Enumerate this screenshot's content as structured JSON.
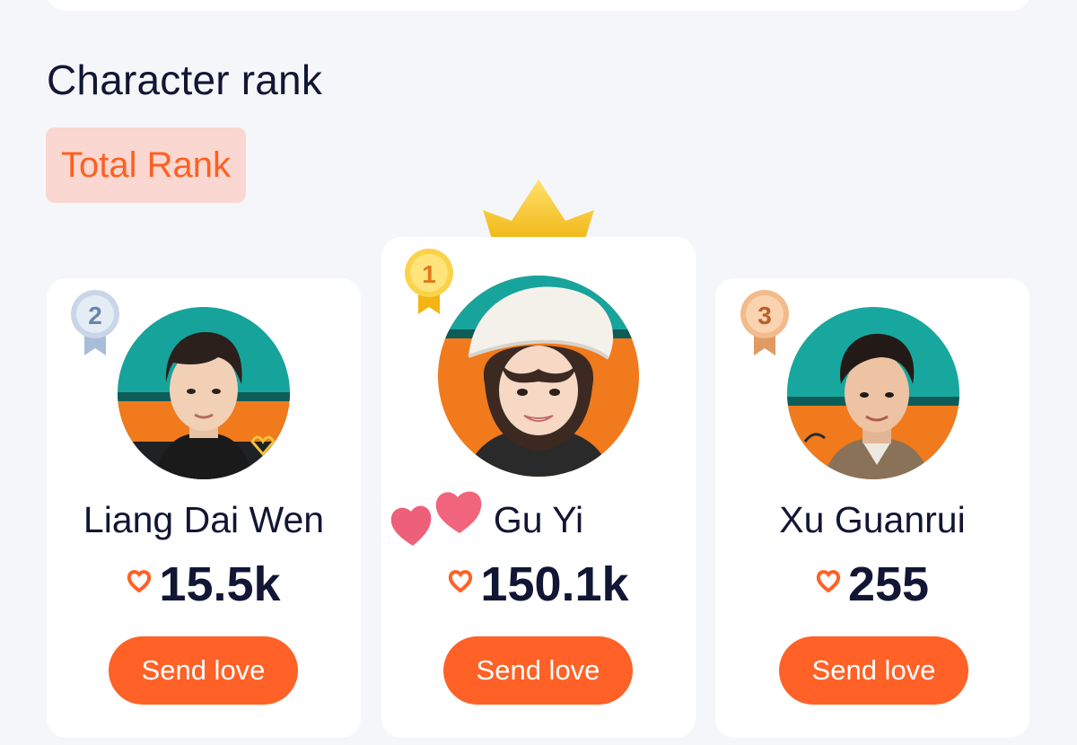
{
  "section": {
    "title": "Character rank",
    "tab_label": "Total Rank"
  },
  "colors": {
    "accent": "#ff6126",
    "tab_bg": "#fad7d0",
    "text_dark": "#121634",
    "page_bg": "#f5f6f9",
    "gold": "#f7c21a",
    "silver": "#aebfd8",
    "bronze": "#e7a673"
  },
  "ranking": [
    {
      "rank": "1",
      "name": "Gu Yi",
      "score": "150.1k",
      "button": "Send love",
      "medal": "gold-medal-icon"
    },
    {
      "rank": "2",
      "name": "Liang Dai Wen",
      "score": "15.5k",
      "button": "Send love",
      "medal": "silver-medal-icon"
    },
    {
      "rank": "3",
      "name": "Xu Guanrui",
      "score": "255",
      "button": "Send love",
      "medal": "bronze-medal-icon"
    }
  ]
}
